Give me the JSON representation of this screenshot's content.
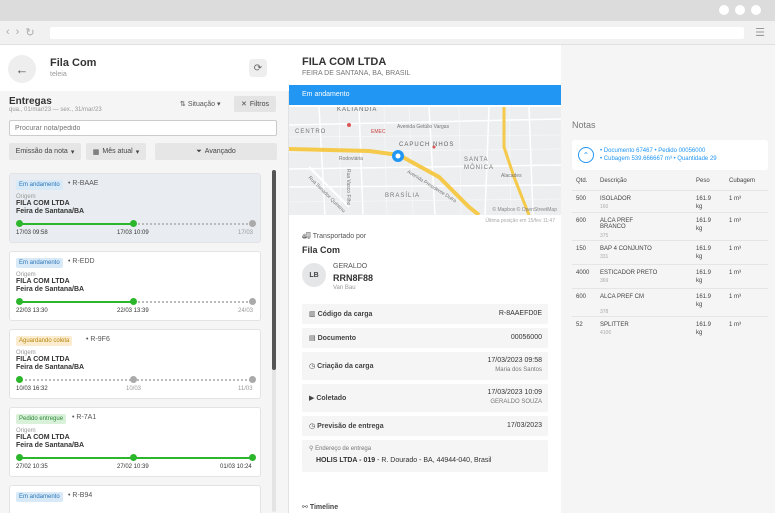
{
  "left": {
    "title": "Fila Com",
    "subtitle": "teleia",
    "section_title": "Entregas",
    "date_range": "qua., 01/mar/23 — sex., 31/mar/23",
    "situacao_label": "Situação",
    "filtros_label": "Filtros",
    "search_placeholder": "Procurar nota/pedido",
    "filter_emissao": "Emissão da nota",
    "filter_mes": "Mês atual",
    "filter_avancado": "Avançado",
    "cards": [
      {
        "badge": "Em andamento",
        "ref": "• R-BAAE",
        "origin_label": "Origem",
        "origin_name": "FILA  COM  LTDA",
        "origin_city": "Feira de Santana/BA",
        "t1": "17/03 09:58",
        "t2": "17/03 10:09",
        "t3": "17/03"
      },
      {
        "badge": "Em andamento",
        "ref": "• R-EDD",
        "origin_label": "Origem",
        "origin_name": "FILA  COM  LTDA",
        "origin_city": "Feira de Santana/BA",
        "t1": "22/03 13:30",
        "t2": "22/03 13:39",
        "t3": "24/03"
      },
      {
        "badge": "Aguardando coleta",
        "ref": "• R-9F6",
        "origin_label": "Origem",
        "origin_name": "FILA  COM  LTDA",
        "origin_city": "Feira de Santana/BA",
        "t1": "10/03 16:32",
        "t2": "10/03",
        "t3": "11/03"
      },
      {
        "badge": "Pedido entregue",
        "ref": "• R-7A1",
        "origin_label": "Origem",
        "origin_name": "FILA  COM  LTDA",
        "origin_city": "Feira de Santana/BA",
        "t1": "27/02 10:35",
        "t2": "27/02 10:39",
        "t3": "01/03 10:24"
      },
      {
        "badge": "Em andamento",
        "ref": "• R-B94"
      }
    ]
  },
  "center": {
    "company": "FILA  COM  LTDA",
    "address": "FEIRA DE SANTANA, BA, BRASIL",
    "status": "Em andamento",
    "map_labels": [
      "KALIANDIA",
      "CENTRO",
      "EMEC",
      "Avenida Getúlio Vargas",
      "CAPUCH NHOS",
      "Rodoviária",
      "SANTA",
      "MÔNICA",
      "Alacades",
      "BRASÍLIA",
      "Avenida Presidente Dutra",
      "Rua Senador Quintino",
      "Rua Vasco Filho"
    ],
    "map_credit": "© Mapbox © OpenStreetMap",
    "map_caption": "Última posição em 15/fev 11:47",
    "transported_label": "Transportado por",
    "carrier": "Fila Com",
    "driver_initials": "LB",
    "driver_name": "GERALDO",
    "driver_plate": "RRN8F88",
    "driver_type": "Van Bau",
    "rows": [
      {
        "label": "Código da carga",
        "value": "R-8AAEFD0E"
      },
      {
        "label": "Documento",
        "value": "00056000"
      },
      {
        "label": "Criação da carga",
        "value": "17/03/2023 09:58",
        "sub": "Maria dos Santos"
      },
      {
        "label": "Coletado",
        "value": "17/03/2023 10:09",
        "sub": "GERALDO SOUZA"
      },
      {
        "label": "Previsão de entrega",
        "value": "17/03/2023"
      }
    ],
    "endereco_label": "Endereço de entrega",
    "endereco_company": "HOLIS LTDA - 019",
    "endereco_value": "- R. Dourado - BA, 44944-040, Brasil",
    "timeline_label": "Timeline"
  },
  "right": {
    "title": "Notas",
    "doc_line1": "• Documento 67467 • Pedido 00056000",
    "doc_line2": "• Cubagem 539.666667 m³ • Quantidade 29",
    "headers": [
      "Qtd.",
      "Descrição",
      "Peso",
      "Cubagem"
    ],
    "items": [
      {
        "qtd": "500",
        "desc": "ISOLADOR",
        "code": "160",
        "peso": "161.9",
        "unit": "kg",
        "cub": "1 m³"
      },
      {
        "qtd": "600",
        "desc": "ALCA PREF BRANCO",
        "code": "375",
        "peso": "161.9",
        "unit": "kg",
        "cub": "1 m³"
      },
      {
        "qtd": "150",
        "desc": "BAP 4 CONJUNTO",
        "code": "331",
        "peso": "161.9",
        "unit": "kg",
        "cub": "1 m³"
      },
      {
        "qtd": "4000",
        "desc": "ESTICADOR PRETO",
        "code": "369",
        "peso": "161.9",
        "unit": "kg",
        "cub": "1 m³"
      },
      {
        "qtd": "600",
        "desc": "ALCA PREF CM",
        "code": "378",
        "peso": "161.9",
        "unit": "kg",
        "cub": "1 m³"
      },
      {
        "qtd": "52",
        "desc": "SPLITTER",
        "code": "4106",
        "peso": "161.9",
        "unit": "kg",
        "cub": "1 m³"
      }
    ]
  }
}
